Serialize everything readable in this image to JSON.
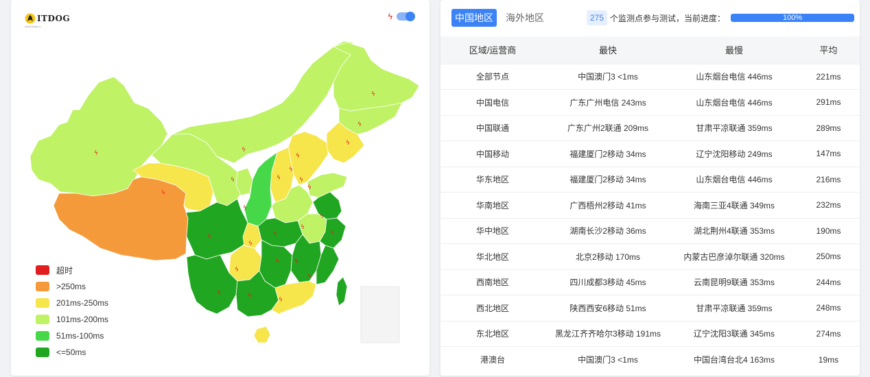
{
  "logo": {
    "name": "ITDOG",
    "tagline": "www.itdog.cn"
  },
  "colors": {
    "timeout": "#e01e1e",
    "over250": "#f59a3a",
    "r201_250": "#f7e54c",
    "r101_200": "#bff264",
    "r51_100": "#47d84a",
    "le50": "#21a621",
    "accent": "#3b82f6"
  },
  "legend": [
    {
      "label": "超时",
      "color": "#e01e1e"
    },
    {
      "label": ">250ms",
      "color": "#f59a3a"
    },
    {
      "label": "201ms-250ms",
      "color": "#f7e54c"
    },
    {
      "label": "101ms-200ms",
      "color": "#bff264"
    },
    {
      "label": "51ms-100ms",
      "color": "#47d84a"
    },
    {
      "label": "<=50ms",
      "color": "#21a621"
    }
  ],
  "tabs": {
    "domestic": "中国地区",
    "overseas": "海外地区"
  },
  "progress": {
    "count": "275",
    "text": "个监测点参与测试，当前进度：",
    "percent_label": "100%",
    "value": 1.0
  },
  "table": {
    "headers": [
      "区域/运营商",
      "最快",
      "最慢",
      "平均"
    ],
    "rows": [
      [
        "全部节点",
        "中国澳门3 <1ms",
        "山东烟台电信 446ms",
        "221ms"
      ],
      [
        "中国电信",
        "广东广州电信 243ms",
        "山东烟台电信 446ms",
        "291ms"
      ],
      [
        "中国联通",
        "广东广州2联通 209ms",
        "甘肃平凉联通 359ms",
        "289ms"
      ],
      [
        "中国移动",
        "福建厦门2移动 34ms",
        "辽宁沈阳移动 249ms",
        "147ms"
      ],
      [
        "华东地区",
        "福建厦门2移动 34ms",
        "山东烟台电信 446ms",
        "216ms"
      ],
      [
        "华南地区",
        "广西梧州2移动 41ms",
        "海南三亚4联通 349ms",
        "232ms"
      ],
      [
        "华中地区",
        "湖南长沙2移动 36ms",
        "湖北荆州4联通 353ms",
        "190ms"
      ],
      [
        "华北地区",
        "北京2移动 170ms",
        "内蒙古巴彦淖尔联通 320ms",
        "250ms"
      ],
      [
        "西南地区",
        "四川成都3移动 45ms",
        "云南昆明9联通 353ms",
        "244ms"
      ],
      [
        "西北地区",
        "陕西西安6移动 51ms",
        "甘肃平凉联通 359ms",
        "248ms"
      ],
      [
        "东北地区",
        "黑龙江齐齐哈尔3移动 191ms",
        "辽宁沈阳3联通 345ms",
        "274ms"
      ],
      [
        "港澳台",
        "中国澳门3 <1ms",
        "中国台湾台北4 163ms",
        "19ms"
      ]
    ]
  }
}
